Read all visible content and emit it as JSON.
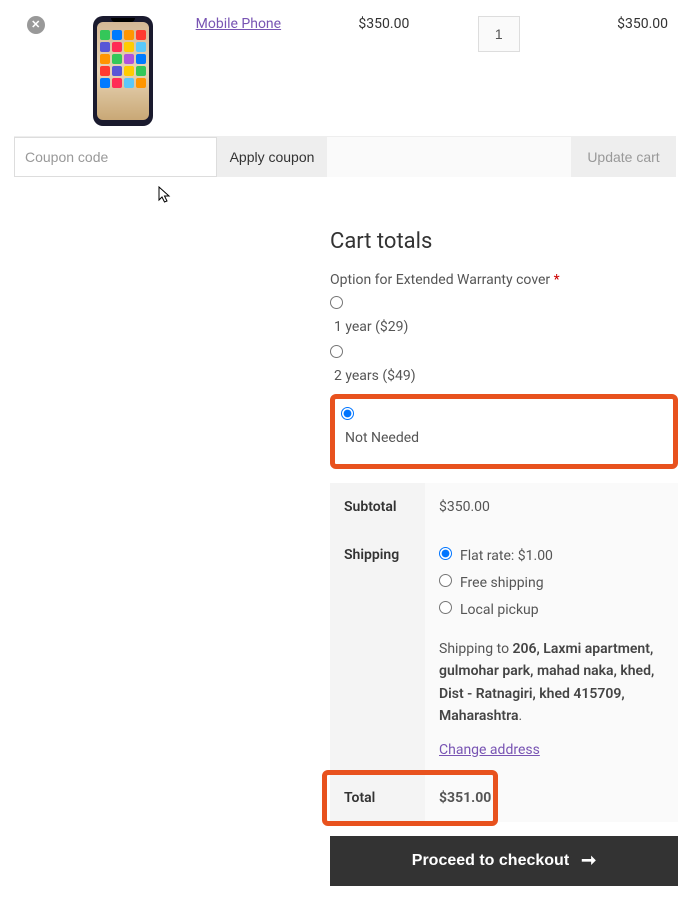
{
  "cart": {
    "items": [
      {
        "name": "Mobile Phone",
        "price": "$350.00",
        "qty": "1",
        "subtotal": "$350.00"
      }
    ],
    "coupon_placeholder": "Coupon code",
    "apply_label": "Apply coupon",
    "update_label": "Update cart"
  },
  "totals": {
    "title": "Cart totals",
    "warranty_label": "Option for Extended Warranty cover ",
    "warranty_required": "*",
    "warranty_options": {
      "opt1": "1 year ($29)",
      "opt2": "2 years ($49)",
      "opt3": "Not Needed"
    },
    "subtotal_label": "Subtotal",
    "subtotal_value": "$350.00",
    "shipping_label": "Shipping",
    "shipping_options": {
      "flat": "Flat rate: $1.00",
      "free": "Free shipping",
      "local": "Local pickup"
    },
    "shipping_to_prefix": "Shipping to ",
    "shipping_address": "206, Laxmi apartment, gulmohar park, mahad naka, khed, Dist - Ratnagiri, khed 415709, Maharashtra",
    "shipping_to_suffix": ".",
    "change_address": "Change address",
    "total_label": "Total",
    "total_value": "$351.00",
    "checkout_label": "Proceed to checkout"
  },
  "highlight_color": "#e8521e"
}
